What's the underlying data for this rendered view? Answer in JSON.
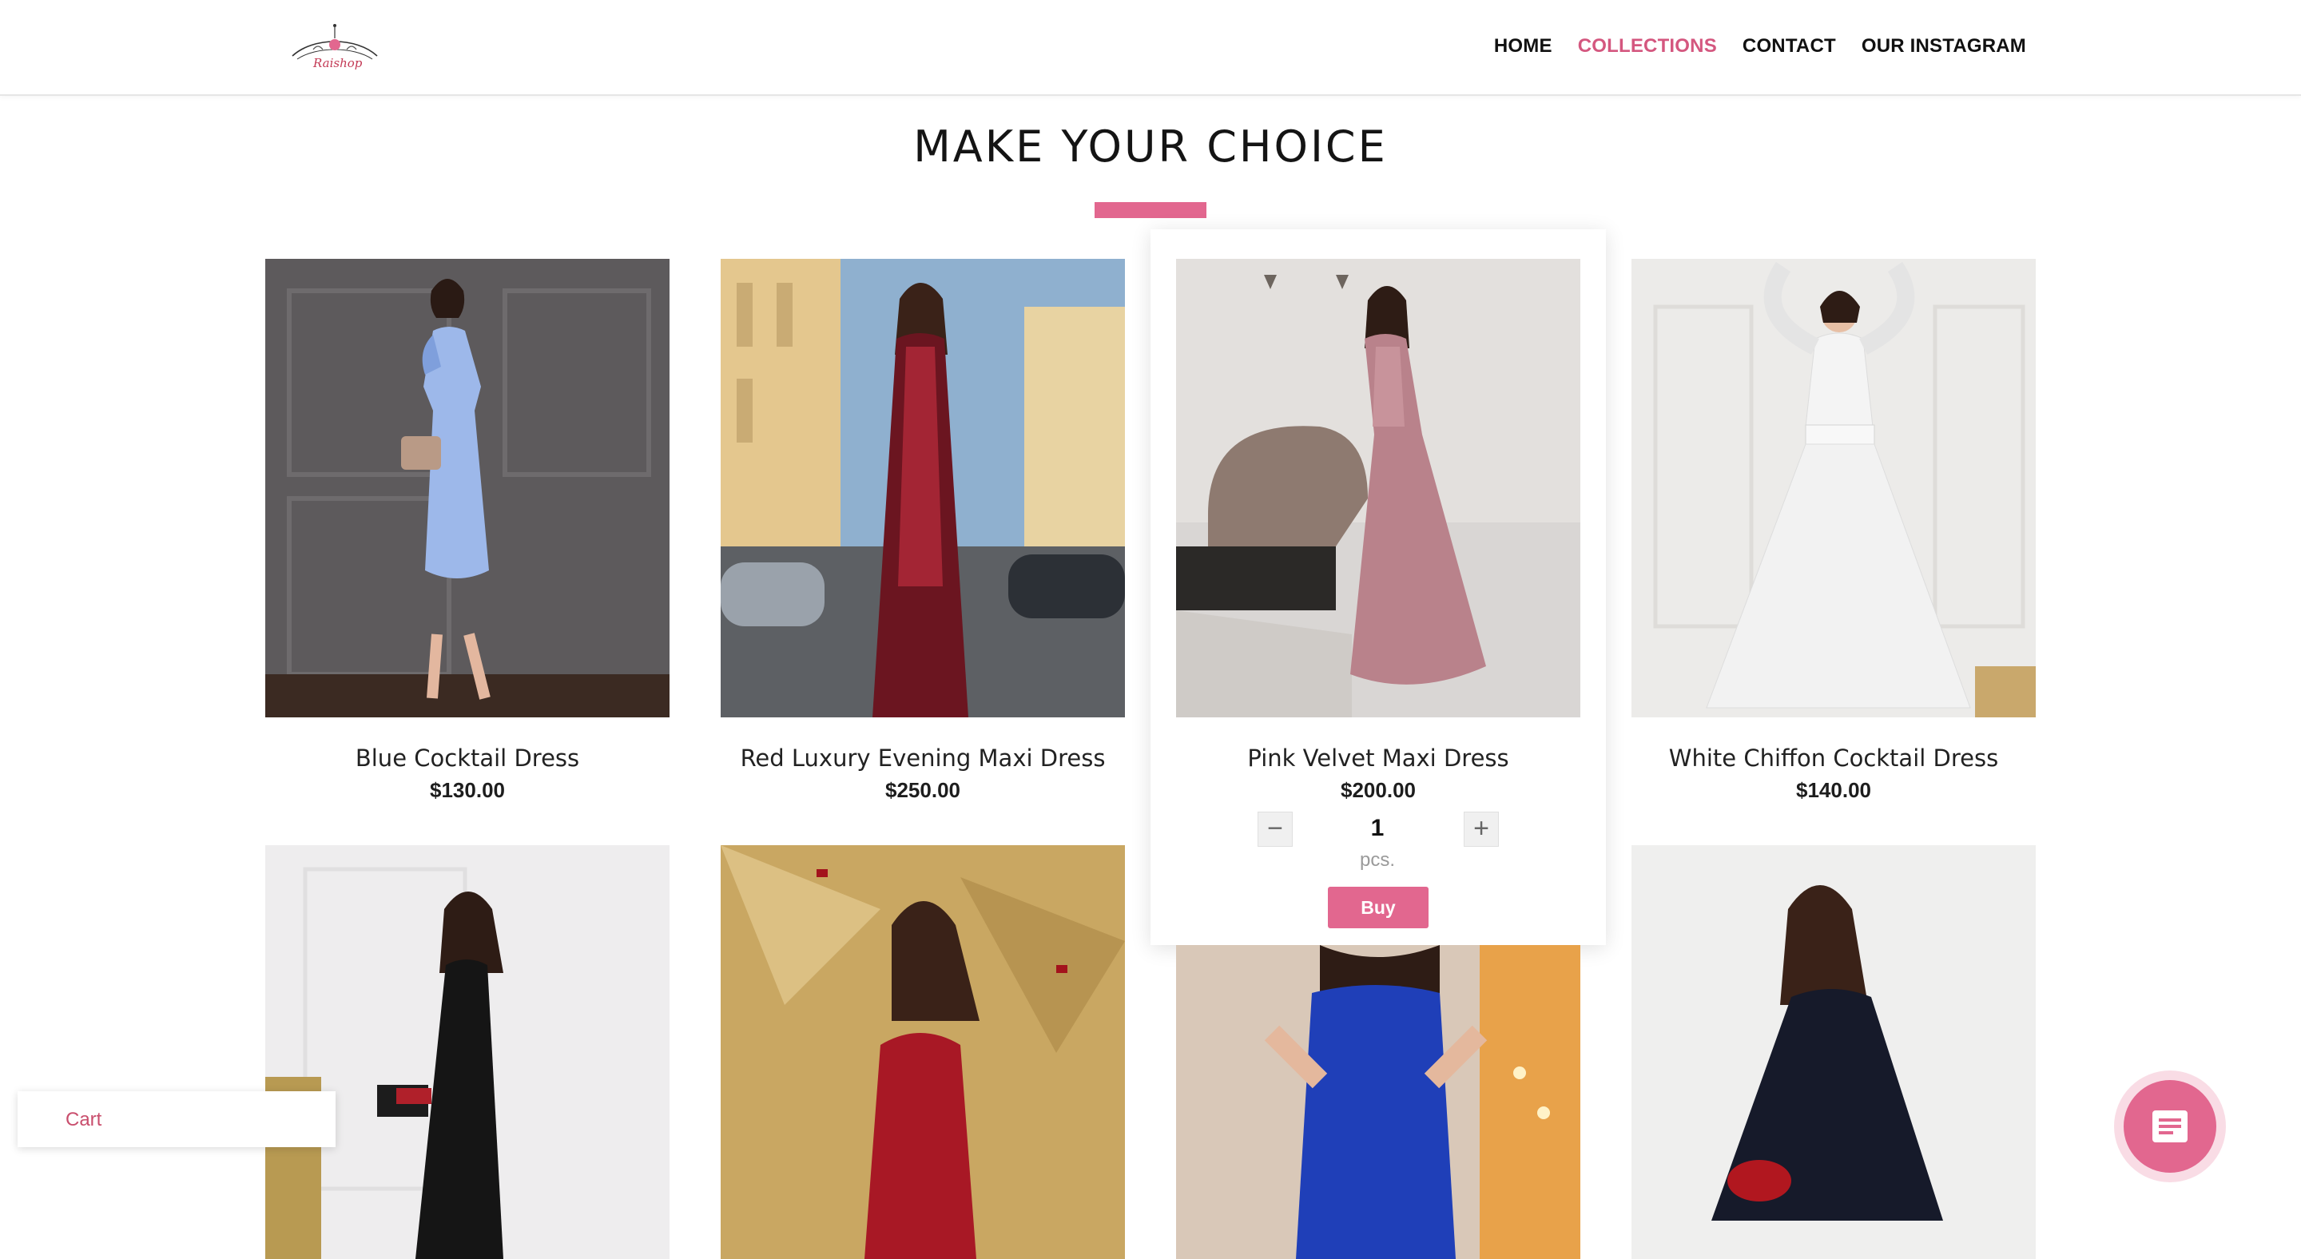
{
  "header": {
    "logo_text": "Raishop",
    "nav": [
      {
        "label": "HOME",
        "active": false
      },
      {
        "label": "COLLECTIONS",
        "active": true
      },
      {
        "label": "CONTACT",
        "active": false
      },
      {
        "label": "OUR INSTAGRAM",
        "active": false
      }
    ]
  },
  "section": {
    "title": "MAKE YOUR CHOICE"
  },
  "products": [
    {
      "name": "Blue Cocktail Dress",
      "price": "$130.00"
    },
    {
      "name": "Red Luxury Evening Maxi Dress",
      "price": "$250.00"
    },
    {
      "name": "Pink Velvet Maxi Dress",
      "price": "$200.00"
    },
    {
      "name": "White Chiffon Cocktail Dress",
      "price": "$140.00"
    }
  ],
  "selected_product": {
    "quantity": "1",
    "unit": "pcs.",
    "buy_label": "Buy",
    "minus": "−",
    "plus": "+"
  },
  "cart": {
    "label": "Cart"
  },
  "colors": {
    "accent": "#e2678f",
    "active_nav": "#d4577f"
  }
}
